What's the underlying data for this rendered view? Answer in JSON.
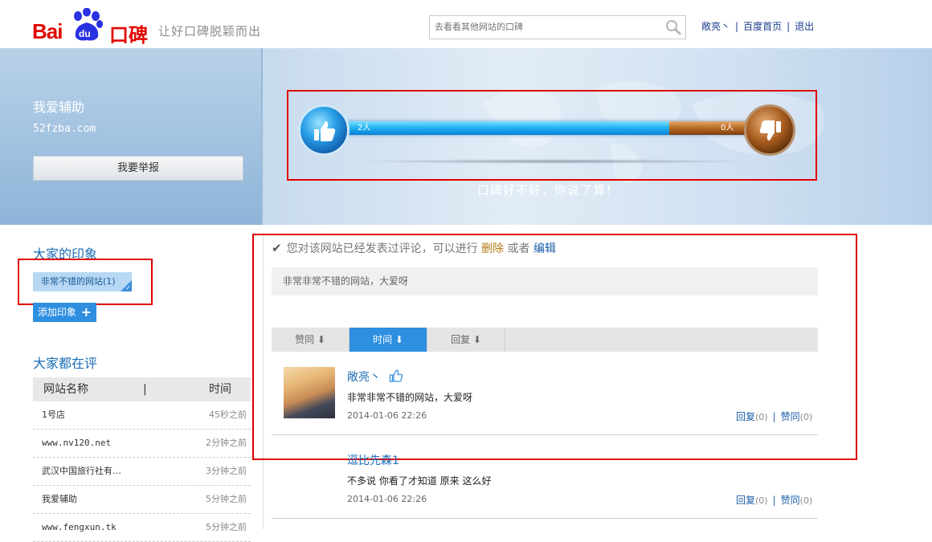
{
  "header": {
    "logo_text_bai": "Bai",
    "logo_text_du": "du",
    "logo_text_koubei": "口碑",
    "slogan": "让好口碑脱颖而出",
    "search_placeholder": "去看看其他网站的口碑",
    "links": {
      "user": "敞亮丶",
      "home": "百度首页",
      "logout": "退出"
    }
  },
  "banner": {
    "site_name": "我爱辅助",
    "domain": "52fzba.com",
    "report_button": "我要举报",
    "good_count_label": "2人",
    "bad_count_label": "0人",
    "good_votes": 2,
    "bad_votes": 0,
    "good_ratio": 0.78,
    "tagline": "口碑好不好，你说了算！",
    "colors": {
      "good": "#23b5f2",
      "bad": "#b86a23"
    }
  },
  "impressions": {
    "title": "大家的印象",
    "tags": [
      {
        "label": "非常不错的网站",
        "count": "(1)"
      }
    ],
    "add_button": "添加印象"
  },
  "reviews_list": {
    "title": "大家都在评",
    "col_name": "网站名称",
    "col_sep": "|",
    "col_time": "时间",
    "rows": [
      {
        "name": "1号店",
        "time": "45秒之前"
      },
      {
        "name": "www.nv120.net",
        "time": "2分钟之前"
      },
      {
        "name": "武汉中国旅行社有…",
        "time": "3分钟之前"
      },
      {
        "name": "我爱辅助",
        "time": "5分钟之前"
      },
      {
        "name": "www.fengxun.tk",
        "time": "5分钟之前"
      }
    ]
  },
  "main": {
    "notice_prefix": "您对该网站已经发表过评论，可以进行",
    "notice_delete": "删除",
    "notice_or": "或者",
    "notice_edit": "编辑",
    "my_comment": "非常非常不错的网站，大爱呀",
    "sort_tabs": [
      {
        "label": "赞同 ⬇",
        "active": false
      },
      {
        "label": "时间 ⬇",
        "active": true
      },
      {
        "label": "回复 ⬇",
        "active": false
      }
    ],
    "comments": [
      {
        "user": "敞亮丶",
        "text": "非常非常不错的网站，大爱呀",
        "date": "2014-01-06 22:26",
        "reply_label": "回复",
        "reply_count": "(0)",
        "agree_label": "赞同",
        "agree_count": "(0)"
      },
      {
        "user": "逗比先森1",
        "text": "不多说 你看了才知道 原来 这么好",
        "date": "2014-01-06 22:26",
        "reply_label": "回复",
        "reply_count": "(0)",
        "agree_label": "赞同",
        "agree_count": "(0)"
      }
    ]
  }
}
